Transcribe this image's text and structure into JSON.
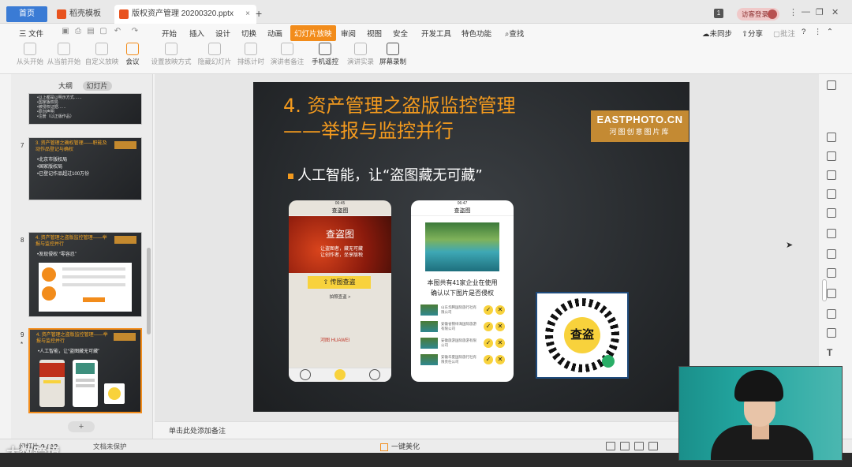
{
  "tabs": {
    "home": "首页",
    "templates": "稻壳模板",
    "file": "版权资产管理 20200320.pptx",
    "login": "访客登录"
  },
  "menu": {
    "file": "三 文件",
    "items": [
      "开始",
      "插入",
      "设计",
      "切换",
      "动画",
      "幻灯片放映",
      "审阅",
      "视图",
      "安全",
      "开发工具",
      "特色功能",
      "查找"
    ],
    "active": "幻灯片放映",
    "right": [
      "未同步",
      "分享",
      "批注"
    ]
  },
  "ribbon": {
    "items": [
      "从头开始",
      "从当前开始",
      "自定义放映",
      "会议",
      "设置放映方式",
      "隐藏幻灯片",
      "排练计时",
      "演讲者备注",
      "手机遥控",
      "演讲实录",
      "屏幕录制"
    ]
  },
  "panel": {
    "tab_outline": "大纲",
    "tab_slides": "幻灯片",
    "slide6_lines": [
      "•以上都是以明示方式……",
      "•国家版权局",
      "•被侵权证据……",
      "•原创声明",
      "•注册（以正版作品）"
    ],
    "slide7": {
      "num": "7",
      "title": "3. 资产管理之确权管理——职能及动作品登记与确权",
      "lines": [
        "•北京市版权局",
        "•国家版权局",
        "•已登记作品超过100万份"
      ]
    },
    "slide8": {
      "num": "8",
      "title": "4. 资产管理之盗版监控管理——举报与监控并行",
      "lines": [
        "•发现侵权 “零容忍”"
      ]
    },
    "slide9": {
      "num": "9",
      "star": "*",
      "title": "4. 资产管理之盗版监控管理——举报与监控并行",
      "lines": [
        "•人工智能，让“盗图藏无可藏”"
      ]
    },
    "add": "+"
  },
  "slide": {
    "title_line1": "4. 资产管理之盗版监控管理",
    "title_line2": "——举报与监控并行",
    "brand_en": "EASTPHOTO.CN",
    "brand_cn": "河图创意图片库",
    "bullet": "人工智能，让“盗图藏无可藏”",
    "phone1": {
      "time": "06:45",
      "nav": "查盗图",
      "hero_title": "查盗图",
      "hero_sub": "让盗图者，藏无可藏\n让创作者，坐享版税",
      "upload": "传图查盗",
      "help": "拍照查盗 >",
      "logos": "河图 HUAWEI"
    },
    "phone2": {
      "time": "06:47",
      "nav": "查盗图",
      "result": "本图共有41家企业在使用\n确认以下图片是否侵权",
      "rows": [
        "山东华腾国际旅行社有限公司",
        "安徽省锦绿海国际旅游有限公司",
        "安徽旅游国际旅游有限公司",
        "安徽华夏国际旅行社有限责任公司"
      ]
    },
    "qr_label": "查盗"
  },
  "notes": "单击此处添加备注",
  "status": {
    "page": "幻灯片 9 / 12",
    "protect": "文档未保护",
    "beautify": "一键美化"
  },
  "watermark": "大数跨境"
}
